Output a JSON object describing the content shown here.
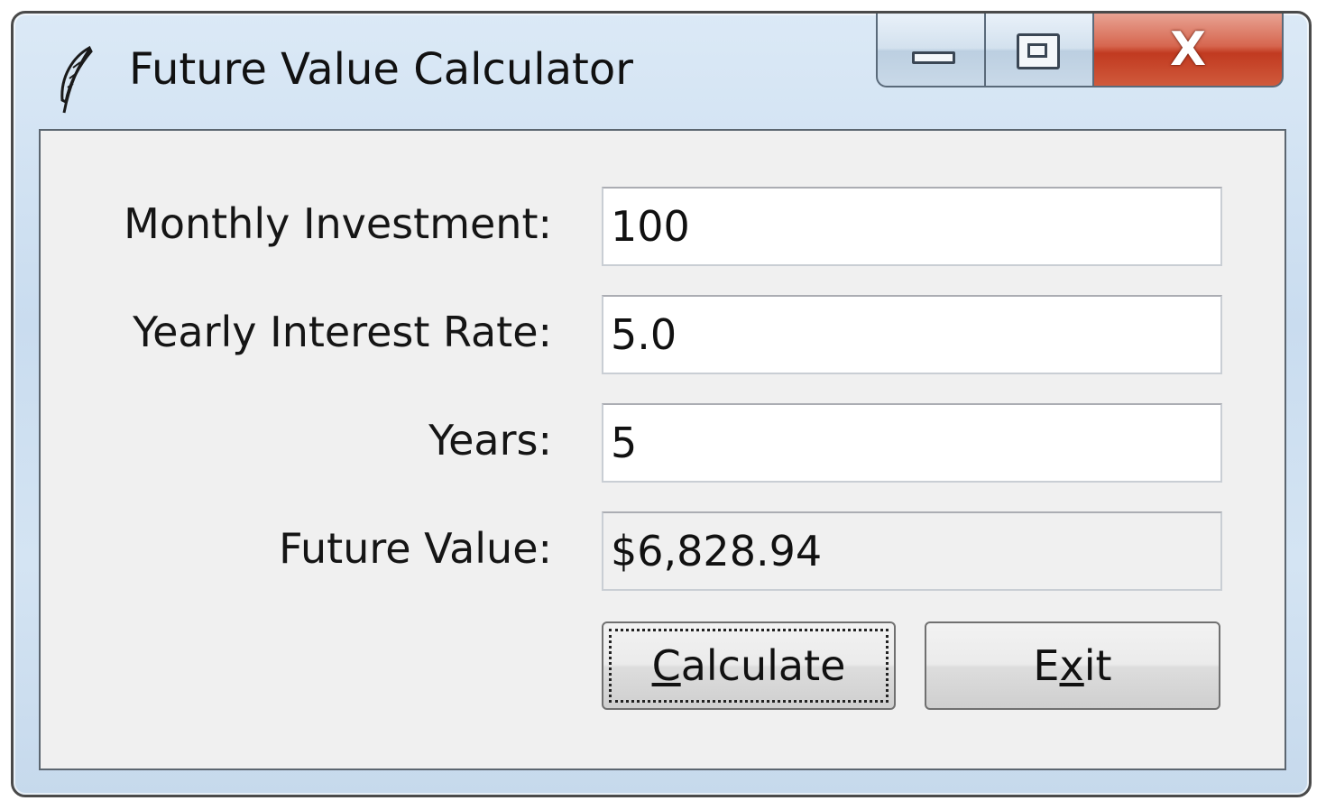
{
  "window": {
    "title": "Future Value Calculator",
    "app_icon": "feather-icon",
    "caption_buttons": {
      "minimize_icon": "minimize-icon",
      "maximize_icon": "maximize-icon",
      "close_glyph": "X"
    }
  },
  "form": {
    "fields": [
      {
        "label": "Monthly Investment:",
        "value": "100",
        "readonly": false
      },
      {
        "label": "Yearly Interest Rate:",
        "value": "5.0",
        "readonly": false
      },
      {
        "label": "Years:",
        "value": "5",
        "readonly": false
      },
      {
        "label": "Future Value:",
        "value": "$6,828.94",
        "readonly": true
      }
    ]
  },
  "buttons": {
    "calculate": {
      "accel": "C",
      "rest": "alculate"
    },
    "exit": {
      "pre": "E",
      "accel": "x",
      "post": "it"
    }
  },
  "colors": {
    "close_button": "#c13a20",
    "client_background": "#f0f0f0",
    "titlebar": "#d4e4f3"
  }
}
